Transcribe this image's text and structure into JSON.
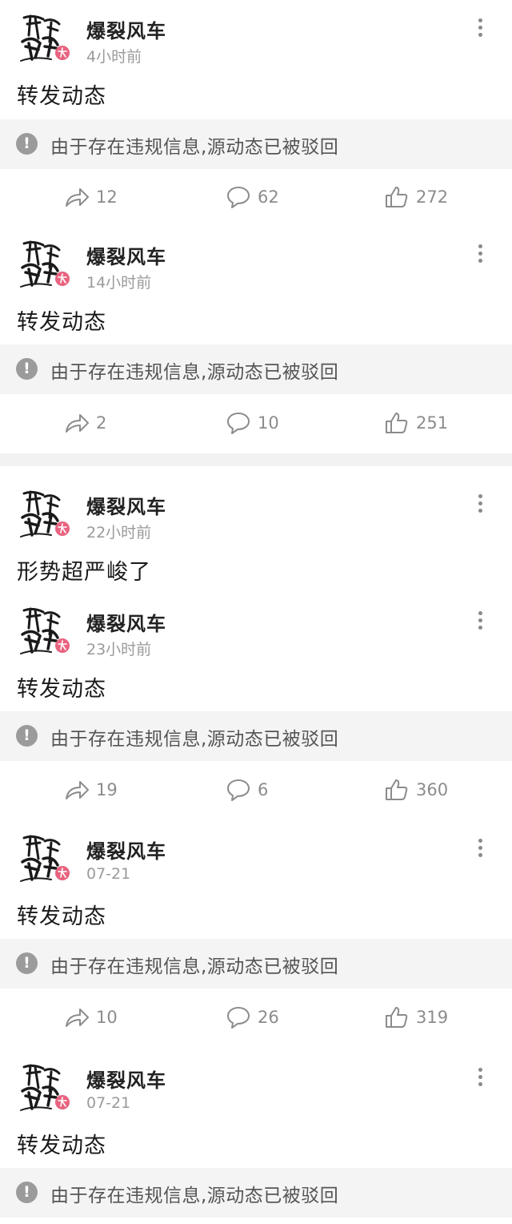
{
  "feed": {
    "posts": [
      {
        "username": "爆裂风车",
        "time": "4小时前",
        "text": "转发动态",
        "notice": "由于存在违规信息,源动态已被驳回",
        "shares": "12",
        "comments": "62",
        "likes": "272"
      },
      {
        "username": "爆裂风车",
        "time": "14小时前",
        "text": "转发动态",
        "notice": "由于存在违规信息,源动态已被驳回",
        "shares": "2",
        "comments": "10",
        "likes": "251"
      },
      {
        "username": "爆裂风车",
        "time": "22小时前",
        "text": "形势超严峻了"
      },
      {
        "username": "爆裂风车",
        "time": "23小时前",
        "text": "转发动态",
        "notice": "由于存在违规信息,源动态已被驳回",
        "shares": "19",
        "comments": "6",
        "likes": "360"
      },
      {
        "username": "爆裂风车",
        "time": "07-21",
        "text": "转发动态",
        "notice": "由于存在违规信息,源动态已被驳回",
        "shares": "10",
        "comments": "26",
        "likes": "319"
      },
      {
        "username": "爆裂风车",
        "time": "07-21",
        "text": "转发动态",
        "notice": "由于存在违规信息,源动态已被驳回"
      }
    ],
    "icons": {
      "more": "more-vertical-icon",
      "notice": "exclamation-circle-icon",
      "share": "share-arrow-icon",
      "comment": "comment-bubble-icon",
      "like": "thumbs-up-icon"
    },
    "colors": {
      "background": "#ffffff",
      "notice_bg": "#f4f4f4",
      "muted": "#9a9a9a",
      "avatar_badge": "#e8637f"
    }
  }
}
